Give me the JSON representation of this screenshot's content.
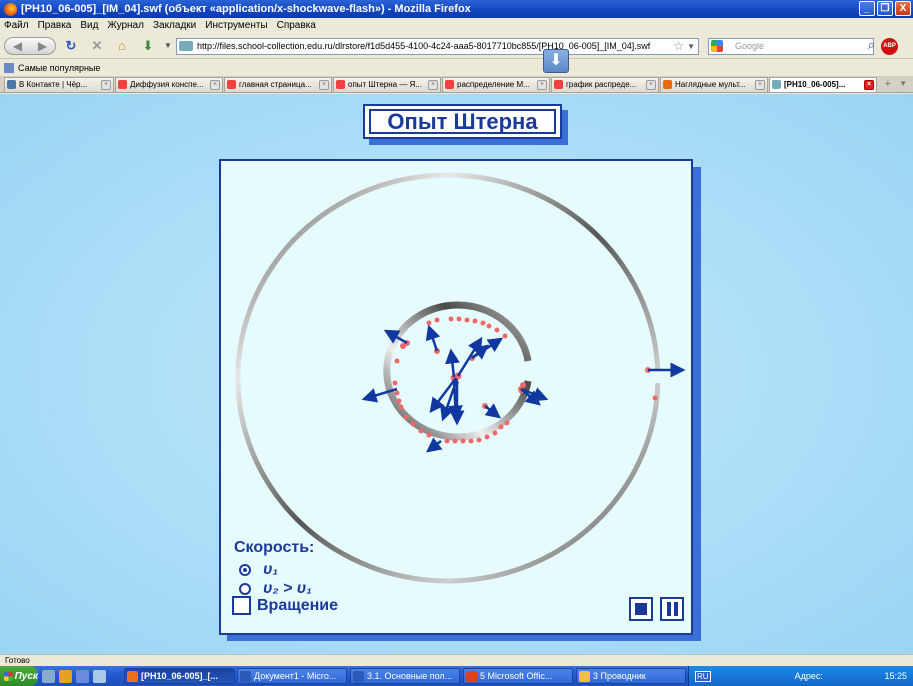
{
  "window": {
    "title": "[PH10_06-005]_[IM_04].swf (объект «application/x-shockwave-flash») - Mozilla Firefox",
    "minimize": "_",
    "maximize": "❐",
    "close": "X"
  },
  "menu": [
    "Файл",
    "Правка",
    "Вид",
    "Журнал",
    "Закладки",
    "Инструменты",
    "Справка"
  ],
  "nav": {
    "url": "http://files.school-collection.edu.ru/dlrstore/f1d5d455-4100-4c24-aaa5-8017710bc855/[PH10_06-005]_[IM_04].swf",
    "search_placeholder": "Google",
    "abp": "ABP"
  },
  "bookmarks": {
    "popular": "Самые популярные"
  },
  "tabs": [
    {
      "label": "В Контакте | Чёр...",
      "color": "#4a76a8"
    },
    {
      "label": "Диффузия конспе...",
      "color": "#f04040"
    },
    {
      "label": "главная страница...",
      "color": "#f04040"
    },
    {
      "label": "опыт Штерна — Я...",
      "color": "#f04040"
    },
    {
      "label": "распределение М...",
      "color": "#f04040"
    },
    {
      "label": "график распреде...",
      "color": "#f04040"
    },
    {
      "label": "Наглядные мульт...",
      "color": "#e86a10"
    },
    {
      "label": "[PH10_06-005]...",
      "color": "#7ab",
      "active": true
    }
  ],
  "simulation": {
    "title": "Опыт Штерна",
    "speed_label": "Скорость:",
    "option1": "υ₁",
    "option2": "υ₂ > υ₁",
    "selected_option": 1,
    "rotation_label": "Вращение",
    "rotation_checked": false,
    "colors": {
      "accent": "#1a3a9a",
      "arrow": "#1038a0",
      "particle": "#f06868"
    }
  },
  "status": {
    "text": "Готово"
  },
  "taskbar": {
    "start": "Пуск",
    "items": [
      {
        "label": "[PH10_06-005]_[...",
        "active": true
      },
      {
        "label": "Документ1 - Micro..."
      },
      {
        "label": "3.1. Основные пол..."
      },
      {
        "label": "5 Microsoft Offic..."
      },
      {
        "label": "3 Проводник"
      }
    ],
    "lang": "RU",
    "address": "Адрес:",
    "clock": "15:25"
  }
}
